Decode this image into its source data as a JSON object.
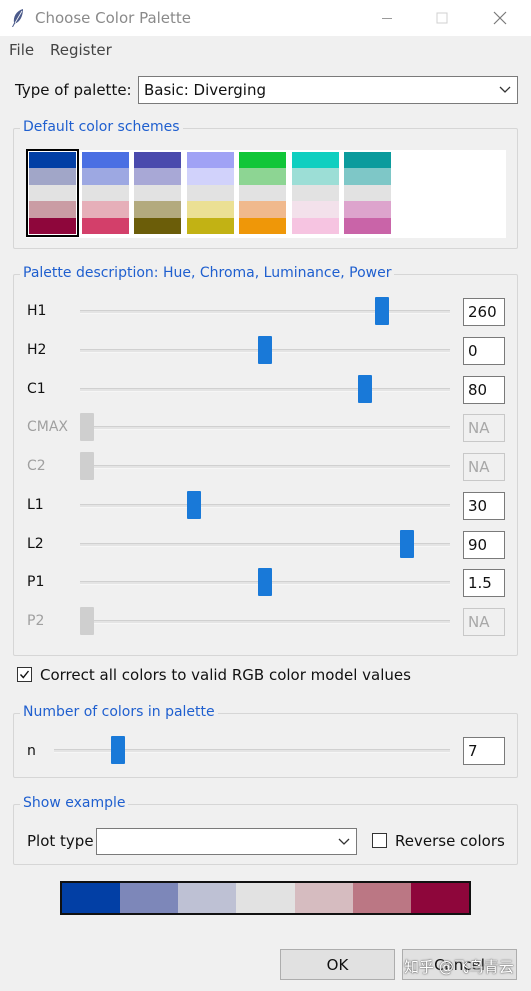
{
  "window": {
    "title": "Choose Color Palette",
    "icon": "feather-quill-icon"
  },
  "menu": {
    "file": "File",
    "register": "Register"
  },
  "palette_type": {
    "label": "Type of palette:",
    "value": "Basic: Diverging"
  },
  "default_schemes": {
    "title": "Default color schemes",
    "selected_index": 0,
    "schemes": [
      [
        "#023fa5",
        "#a1a6c8",
        "#e2e2e2",
        "#ca9ca4",
        "#8e063b"
      ],
      [
        "#4a6fe3",
        "#9da8e2",
        "#e2e2e2",
        "#e6afb9",
        "#d33f6a"
      ],
      [
        "#4a4aad",
        "#a8a8d6",
        "#e2e2e2",
        "#b3aa7e",
        "#6b5d09"
      ],
      [
        "#a0a2f5",
        "#d1d2fb",
        "#e2e2e2",
        "#ebe094",
        "#c2b214"
      ],
      [
        "#11c638",
        "#8dd593",
        "#e2e2e2",
        "#f0b98d",
        "#ef9708"
      ],
      [
        "#0fcfc0",
        "#9cded6",
        "#e2e2e2",
        "#f3e1eb",
        "#f6c4e1"
      ],
      [
        "#0b9b9d",
        "#7ec7c7",
        "#e2e2e2",
        "#dda4cd",
        "#c964a8"
      ]
    ]
  },
  "description": {
    "title": "Palette description: Hue, Chroma, Luminance, Power",
    "sliders": [
      {
        "label": "H1",
        "value": "260",
        "position": 0.83,
        "enabled": true
      },
      {
        "label": "H2",
        "value": "0",
        "position": 0.5,
        "enabled": true
      },
      {
        "label": "C1",
        "value": "80",
        "position": 0.78,
        "enabled": true
      },
      {
        "label": "CMAX",
        "value": "NA",
        "position": 0.0,
        "enabled": false
      },
      {
        "label": "C2",
        "value": "NA",
        "position": 0.0,
        "enabled": false
      },
      {
        "label": "L1",
        "value": "30",
        "position": 0.3,
        "enabled": true
      },
      {
        "label": "L2",
        "value": "90",
        "position": 0.9,
        "enabled": true
      },
      {
        "label": "P1",
        "value": "1.5",
        "position": 0.5,
        "enabled": true
      },
      {
        "label": "P2",
        "value": "NA",
        "position": 0.0,
        "enabled": false
      }
    ]
  },
  "correct_colors": {
    "label": "Correct all colors to valid RGB color model values",
    "checked": true
  },
  "num_colors": {
    "title": "Number of colors in palette",
    "label": "n",
    "value": "7",
    "position": 0.15
  },
  "example": {
    "title": "Show example",
    "plot_type_label": "Plot type",
    "plot_type_value": "",
    "reverse_label": "Reverse colors",
    "reverse_checked": false
  },
  "result_palette": [
    "#023fa5",
    "#7d87b9",
    "#bec1d4",
    "#e2e2e2",
    "#d6bcc0",
    "#bb7784",
    "#8e063b"
  ],
  "buttons": {
    "ok": "OK",
    "cancel": "Cancel"
  },
  "watermark": "知乎 @飞鸟青云"
}
